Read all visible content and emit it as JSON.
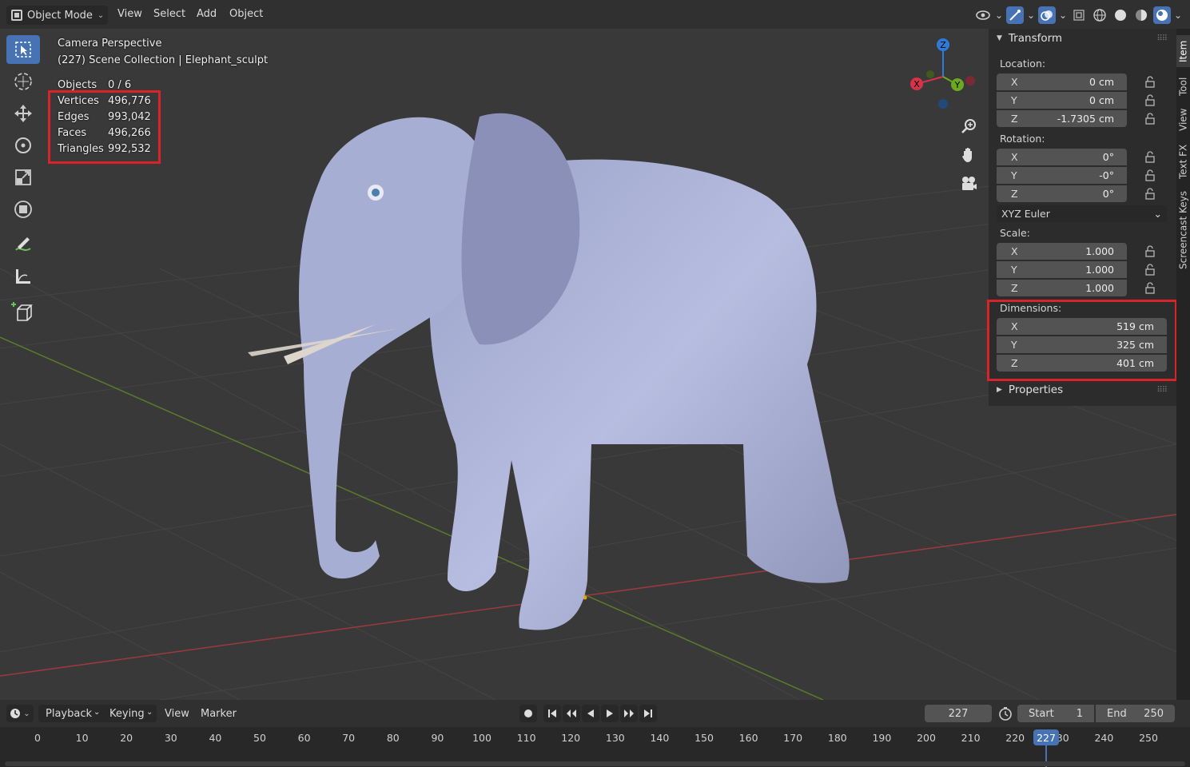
{
  "header": {
    "mode": "Object Mode",
    "menus": [
      "View",
      "Select",
      "Add",
      "Object"
    ]
  },
  "viewport": {
    "camera_label": "Camera Perspective",
    "collection_label": "(227) Scene Collection | Elephant_sculpt",
    "stats": {
      "objects_label": "Objects",
      "objects_value": "0 / 6",
      "vertices_label": "Vertices",
      "vertices_value": "496,776",
      "edges_label": "Edges",
      "edges_value": "993,042",
      "faces_label": "Faces",
      "faces_value": "496,266",
      "triangles_label": "Triangles",
      "triangles_value": "992,532"
    },
    "gizmo": {
      "x": "X",
      "y": "Y",
      "z": "Z"
    },
    "highlight_color": "#d8232a"
  },
  "npanel": {
    "transform_title": "Transform",
    "location_label": "Location:",
    "location": [
      {
        "axis": "X",
        "value": "0 cm"
      },
      {
        "axis": "Y",
        "value": "0 cm"
      },
      {
        "axis": "Z",
        "value": "-1.7305 cm"
      }
    ],
    "rotation_label": "Rotation:",
    "rotation": [
      {
        "axis": "X",
        "value": "0°"
      },
      {
        "axis": "Y",
        "value": "-0°"
      },
      {
        "axis": "Z",
        "value": "0°"
      }
    ],
    "rotation_mode": "XYZ Euler",
    "scale_label": "Scale:",
    "scale": [
      {
        "axis": "X",
        "value": "1.000"
      },
      {
        "axis": "Y",
        "value": "1.000"
      },
      {
        "axis": "Z",
        "value": "1.000"
      }
    ],
    "dimensions_label": "Dimensions:",
    "dimensions": [
      {
        "axis": "X",
        "value": "519 cm"
      },
      {
        "axis": "Y",
        "value": "325 cm"
      },
      {
        "axis": "Z",
        "value": "401 cm"
      }
    ],
    "properties_title": "Properties",
    "tabs": [
      "Item",
      "Tool",
      "View",
      "Text FX",
      "Screencast Keys"
    ]
  },
  "timeline": {
    "menus": [
      "Playback",
      "Keying",
      "View",
      "Marker"
    ],
    "current_frame": "227",
    "start_label": "Start",
    "start_value": "1",
    "end_label": "End",
    "end_value": "250",
    "ticks": [
      "0",
      "10",
      "20",
      "30",
      "40",
      "50",
      "60",
      "70",
      "80",
      "90",
      "100",
      "110",
      "120",
      "130",
      "140",
      "150",
      "160",
      "170",
      "180",
      "190",
      "200",
      "210",
      "220",
      "230",
      "240",
      "250"
    ],
    "accent_color": "#4772b3"
  }
}
